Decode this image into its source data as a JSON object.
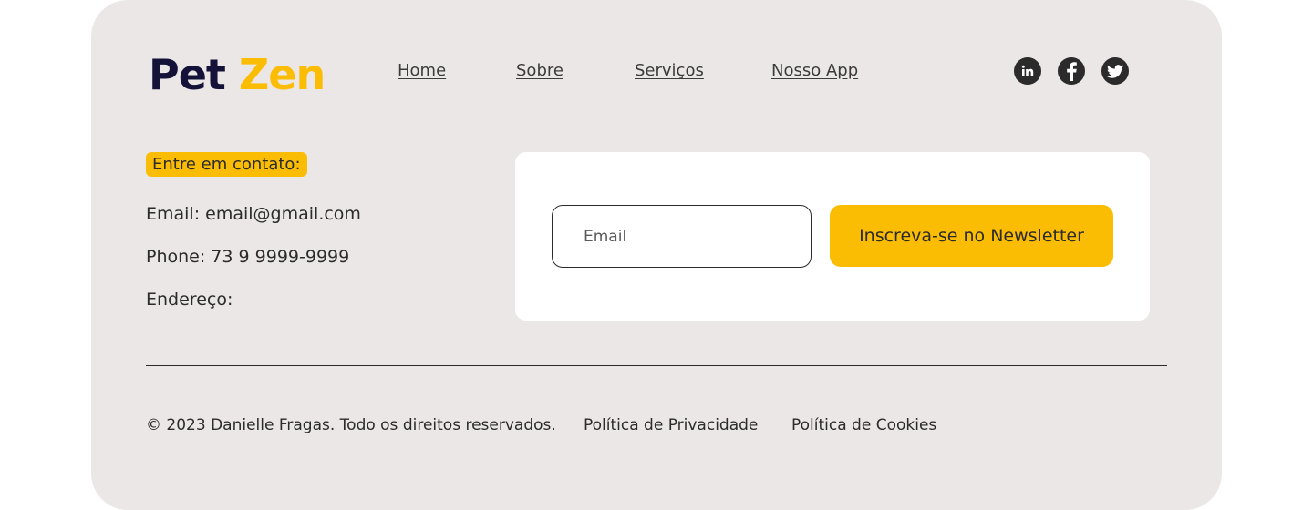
{
  "brand": {
    "part1": "Pet",
    "part2": "Zen",
    "part1_color": "#15123a",
    "part2_color": "#fbbd03"
  },
  "nav": {
    "items": [
      "Home",
      "Sobre",
      "Serviços",
      "Nosso App"
    ]
  },
  "social": {
    "icons": [
      "linkedin-icon",
      "facebook-icon",
      "twitter-icon"
    ]
  },
  "contact": {
    "heading": "Entre em contato:",
    "email": "Email: email@gmail.com",
    "phone": "Phone: 73 9 9999-9999",
    "address": "Endereço:"
  },
  "newsletter": {
    "email_placeholder": "Email",
    "email_value": "",
    "button_label": "Inscreva-se no Newsletter"
  },
  "legal": {
    "copyright": "© 2023 Danielle Fragas. Todo os direitos reservados.",
    "privacy": "Política de Privacidade",
    "cookies": "Política de Cookies"
  },
  "colors": {
    "accent": "#fbbd03",
    "panel": "#ebe7e6",
    "text": "#2b2b2b"
  }
}
